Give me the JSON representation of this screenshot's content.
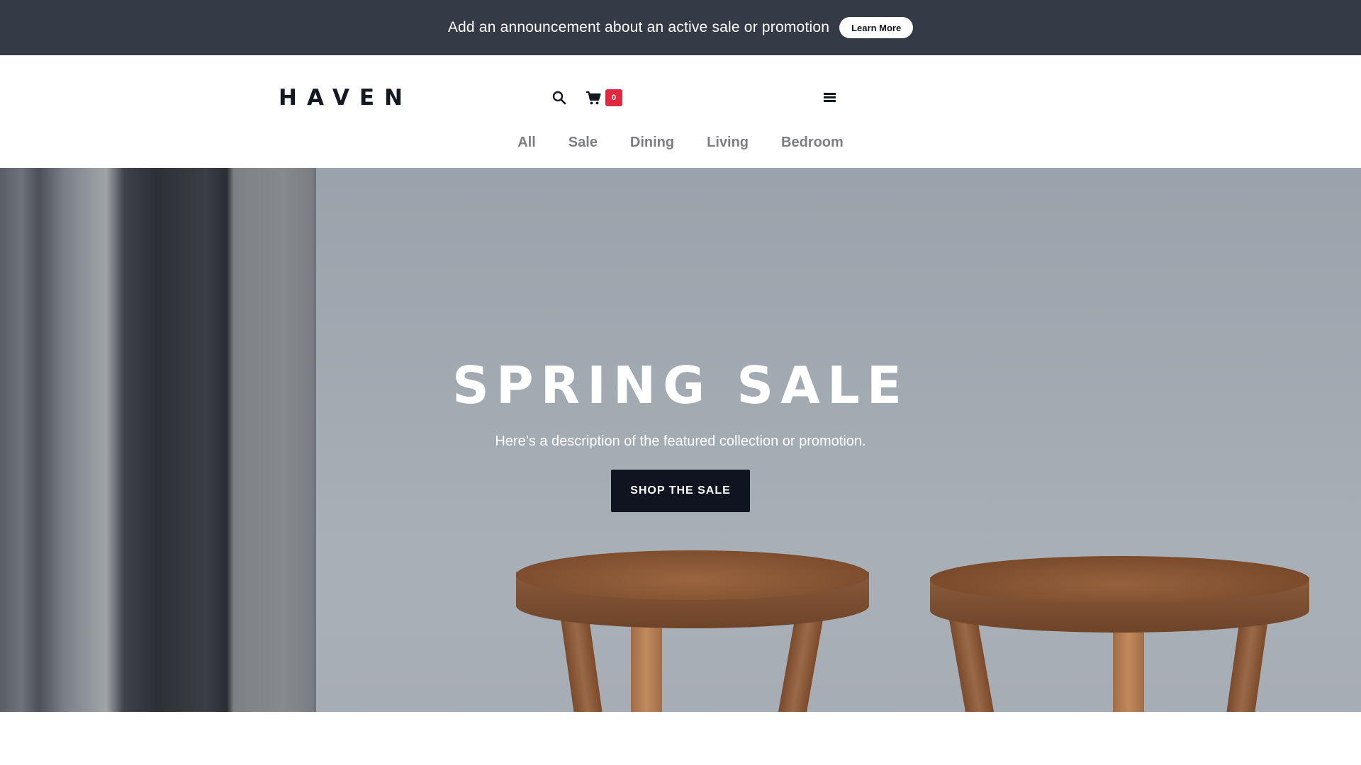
{
  "announcement": {
    "text": "Add an announcement about an active sale or promotion",
    "button_label": "Learn More"
  },
  "header": {
    "logo": "HAVEN",
    "cart_count": "0",
    "icons": [
      "search-icon",
      "cart-icon",
      "hamburger-menu-icon"
    ]
  },
  "nav": {
    "items": [
      {
        "label": "All"
      },
      {
        "label": "Sale"
      },
      {
        "label": "Dining"
      },
      {
        "label": "Living"
      },
      {
        "label": "Bedroom"
      }
    ]
  },
  "hero": {
    "title": "SPRING SALE",
    "description": "Here’s a description of the featured collection or promotion.",
    "button_label": "SHOP THE SALE"
  },
  "colors": {
    "announcement_bg": "#353a47",
    "badge": "#e0283e",
    "hero_button_bg": "#0f1420",
    "nav_text": "#7c7e84"
  }
}
